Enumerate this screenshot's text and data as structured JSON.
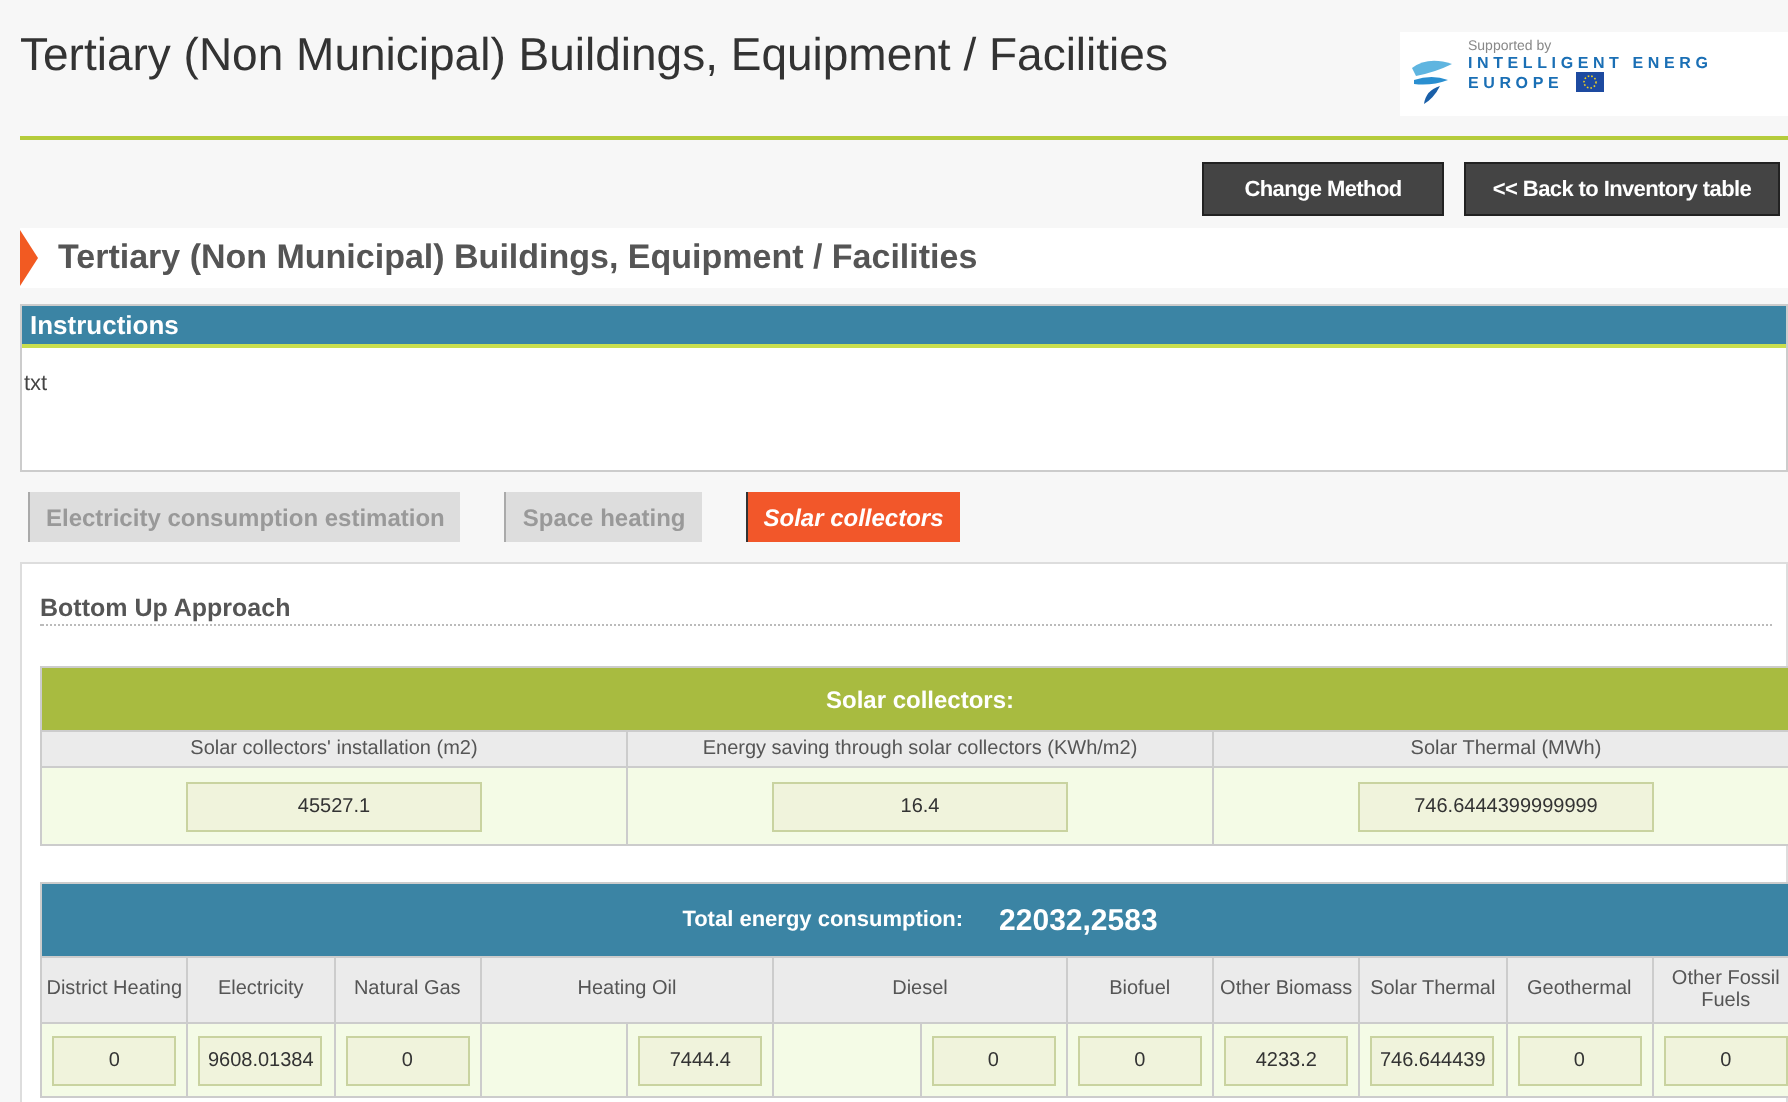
{
  "header": {
    "title": "Tertiary (Non Municipal) Buildings, Equipment / Facilities",
    "logo": {
      "supported": "Supported by",
      "line1": "INTELLIGENT ENERG",
      "line2": "EUROPE"
    }
  },
  "buttons": [
    "Change Method",
    "<< Back to Inventory table"
  ],
  "section_title": "Tertiary (Non Municipal) Buildings, Equipment / Facilities",
  "instructions": {
    "title": "Instructions",
    "text": "txt"
  },
  "tabs": [
    {
      "label": "Electricity consumption estimation",
      "selected": false
    },
    {
      "label": "Space heating",
      "selected": false
    },
    {
      "label": "Solar collectors",
      "selected": true
    }
  ],
  "approach_title": "Bottom Up Approach",
  "solar_table": {
    "title": "Solar collectors:",
    "columns": [
      {
        "label": "Solar collectors' installation (m2)",
        "value": "45527.1"
      },
      {
        "label": "Energy saving through solar collectors (KWh/m2)",
        "value": "16.4"
      },
      {
        "label": "Solar Thermal (MWh)",
        "value": "746.6444399999999"
      }
    ]
  },
  "energy_table": {
    "title": "Total energy consumption:",
    "total": "22032,2583",
    "columns": [
      {
        "label": "District Heating",
        "kind": "single",
        "value": "0"
      },
      {
        "label": "Electricity",
        "kind": "single",
        "value": "9608.01384"
      },
      {
        "label": "Natural Gas",
        "kind": "single",
        "value": "0"
      },
      {
        "label": "Heating Oil",
        "kind": "split",
        "value": "7444.4"
      },
      {
        "label": "Diesel",
        "kind": "split",
        "value": "0"
      },
      {
        "label": "Biofuel",
        "kind": "single",
        "value": "0"
      },
      {
        "label": "Other Biomass",
        "kind": "single",
        "value": "4233.2"
      },
      {
        "label": "Solar Thermal",
        "kind": "single",
        "value": "746.644439"
      },
      {
        "label": "Geothermal",
        "kind": "single",
        "value": "0"
      },
      {
        "label": "Other Fossil Fuels",
        "kind": "single",
        "value": "0"
      }
    ]
  }
}
